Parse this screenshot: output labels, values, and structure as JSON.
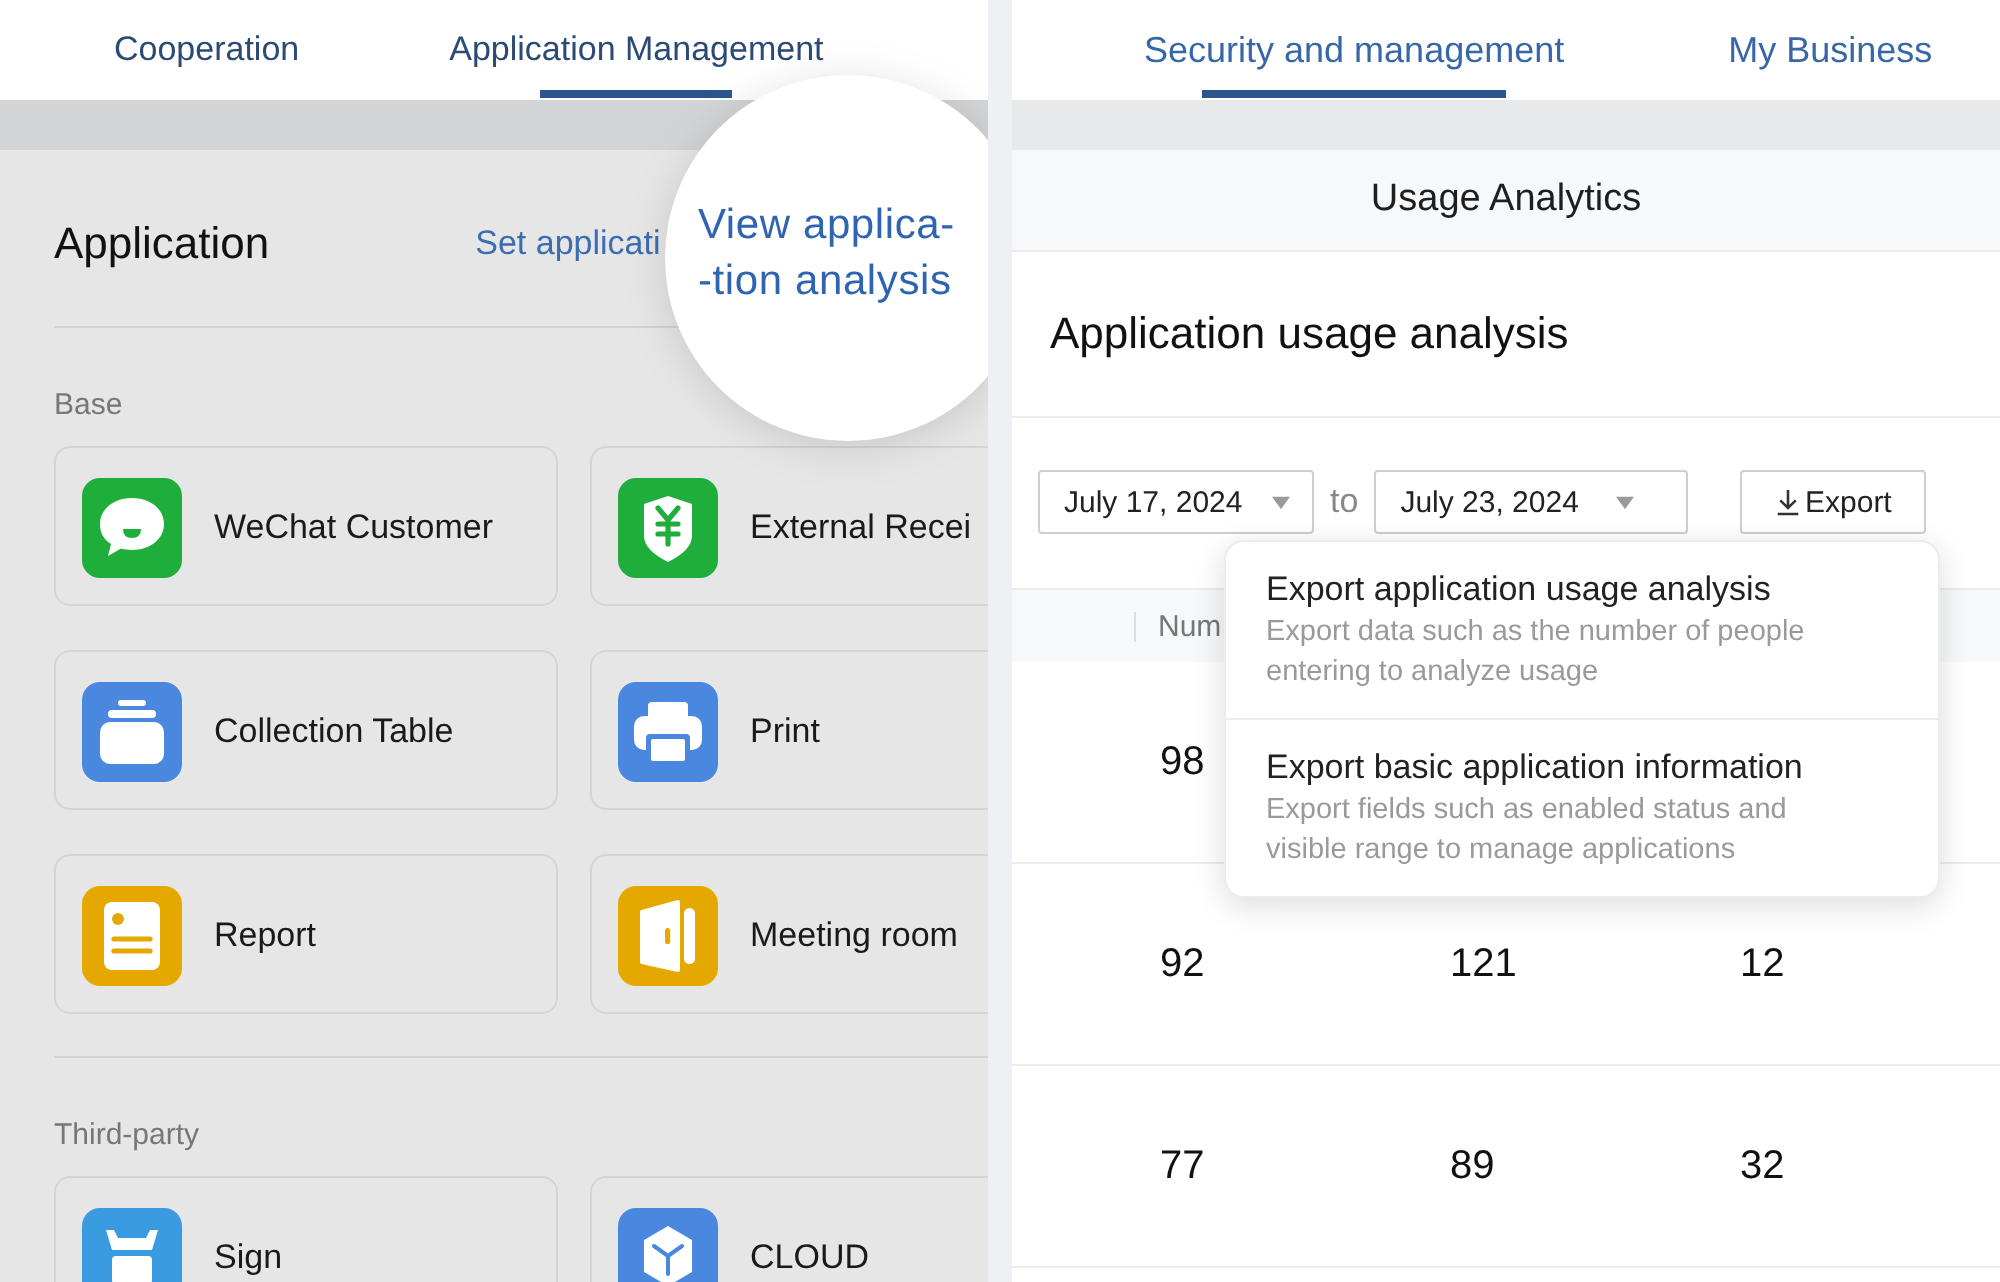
{
  "left_screen": {
    "tabs": [
      {
        "label": "Cooperation",
        "selected": false
      },
      {
        "label": "Application Management",
        "selected": true
      }
    ],
    "section_title": "Application",
    "header_link": "Set applicati",
    "magnifier_text": "View applica-\n-tion analysis",
    "groups": [
      {
        "label": "Base",
        "apps": [
          {
            "name": "WeChat Customer",
            "color": "#1fae3c"
          },
          {
            "name": "External Recei",
            "color": "#1fae3c"
          },
          {
            "name": "Collection Table",
            "color": "#4a88e0"
          },
          {
            "name": "Print",
            "color": "#4a88e0"
          },
          {
            "name": "Report",
            "color": "#e4a800"
          },
          {
            "name": "Meeting room",
            "color": "#e4a800"
          }
        ]
      },
      {
        "label": "Third-party",
        "apps": [
          {
            "name": "Sign",
            "color": "#3b9be0"
          },
          {
            "name": "CLOUD",
            "color": "#4a88e0"
          }
        ]
      }
    ]
  },
  "right_screen": {
    "tabs": [
      {
        "label": "Security and management",
        "selected": true
      },
      {
        "label": "My Business",
        "selected": false
      }
    ],
    "page_title": "Usage Analytics",
    "heading": "Application usage analysis",
    "date_from": "July 17, 2024",
    "date_separator": "to",
    "date_to": "July 23, 2024",
    "export_button": "Export",
    "export_menu": [
      {
        "title": "Export application usage analysis",
        "description": "Export data such as the number of people entering to analyze usage"
      },
      {
        "title": "Export basic application information",
        "description": "Export fields such as enabled status and visible range to manage applications"
      }
    ],
    "table": {
      "columns": [
        "Num"
      ],
      "rows": [
        [
          "98"
        ],
        [
          "92",
          "121",
          "12"
        ],
        [
          "77",
          "89",
          "32"
        ]
      ]
    }
  }
}
